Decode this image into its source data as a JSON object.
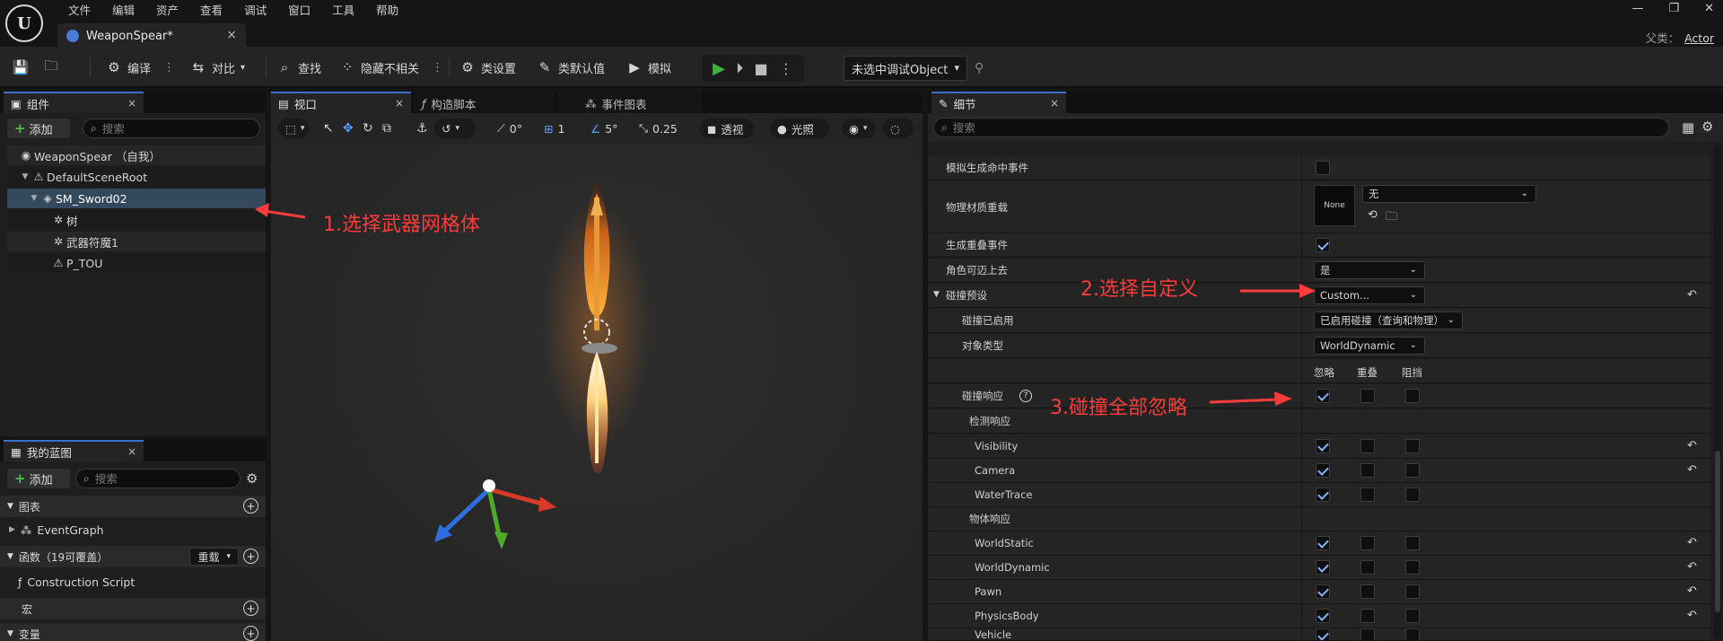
{
  "app": {
    "menu": [
      "文件",
      "编辑",
      "资产",
      "查看",
      "调试",
      "窗口",
      "工具",
      "帮助"
    ],
    "document_tab": "WeaponSpear*",
    "parent_label": "父类：",
    "parent_value": "Actor"
  },
  "toolbar": {
    "compile": "编译",
    "diff": "对比",
    "find": "查找",
    "hide_unrelated": "隐藏不相关",
    "class_settings": "类设置",
    "class_defaults": "类默认值",
    "simulate": "模拟",
    "debug_object": "未选中调试Object"
  },
  "components": {
    "tab": "组件",
    "add_label": "添加",
    "search_placeholder": "搜索",
    "tree": [
      {
        "label": "WeaponSpear （自我）"
      },
      {
        "label": "DefaultSceneRoot"
      },
      {
        "label": "SM_Sword02"
      },
      {
        "label": "树"
      },
      {
        "label": "武器符魔1"
      },
      {
        "label": "P_TOU"
      }
    ]
  },
  "my_blueprint": {
    "tab": "我的蓝图",
    "add_label": "添加",
    "search_placeholder": "搜索",
    "graphs_header": "图表",
    "event_graph": "EventGraph",
    "functions_header": "函数（19可覆盖）",
    "override_label": "重载",
    "construction_script": "Construction Script",
    "macros_header": "宏",
    "variables_header": "变量"
  },
  "viewport": {
    "tabs": [
      "视口",
      "构造脚本",
      "事件图表"
    ],
    "rot_snap": "0°",
    "grid_snap": "1",
    "angle_snap": "5°",
    "scale_snap": "0.25",
    "view_mode": "透视",
    "lighting": "光照"
  },
  "details": {
    "tab": "细节",
    "search_placeholder": "搜索",
    "rows": {
      "sim_hit": "模拟生成命中事件",
      "phys_override": "物理材质重载",
      "phys_none": "None",
      "phys_value": "无",
      "gen_overlap": "生成重叠事件",
      "can_step": "角色可迈上去",
      "can_step_value": "是",
      "preset": "碰撞预设",
      "preset_value": "Custom...",
      "enabled": "碰撞已启用",
      "enabled_value": "已启用碰撞（查询和物理）",
      "object_type": "对象类型",
      "object_type_value": "WorldDynamic",
      "col_ignore": "忽略",
      "col_overlap": "重叠",
      "col_block": "阻挡",
      "response": "碰撞响应",
      "trace_response": "检测响应",
      "object_response": "物体响应"
    },
    "channels": [
      "Visibility",
      "Camera",
      "WaterTrace",
      "WorldStatic",
      "WorldDynamic",
      "Pawn",
      "PhysicsBody",
      "Vehicle"
    ]
  },
  "annotations": {
    "step1": "1.选择武器网格体",
    "step2": "2.选择自定义",
    "step3": "3.碰撞全部忽略"
  }
}
